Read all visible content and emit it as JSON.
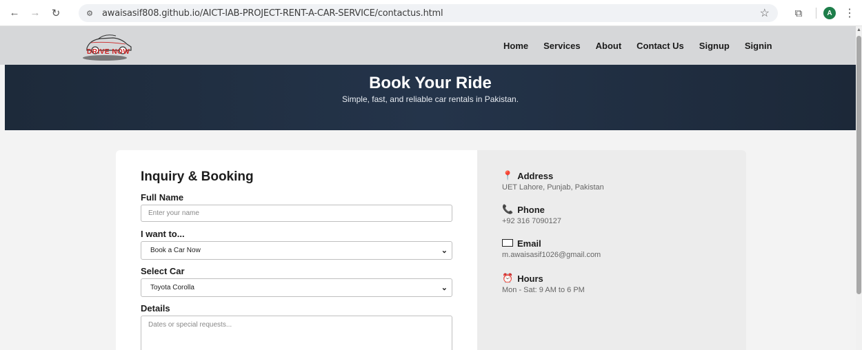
{
  "browser": {
    "url": "awaisasif808.github.io/AICT-IAB-PROJECT-RENT-A-CAR-SERVICE/contactus.html",
    "profile_initial": "A"
  },
  "site": {
    "logo_text": "DRIVE NOW",
    "nav": [
      "Home",
      "Services",
      "About",
      "Contact Us",
      "Signup",
      "Signin"
    ]
  },
  "hero": {
    "title": "Book Your Ride",
    "subtitle": "Simple, fast, and reliable car rentals in Pakistan."
  },
  "form": {
    "title": "Inquiry & Booking",
    "full_name_label": "Full Name",
    "full_name_placeholder": "Enter your name",
    "want_label": "I want to...",
    "want_value": "Book a Car Now",
    "car_label": "Select Car",
    "car_value": "Toyota Corolla",
    "details_label": "Details",
    "details_placeholder": "Dates or special requests..."
  },
  "contact": {
    "address_label": "Address",
    "address_value": "UET Lahore, Punjab, Pakistan",
    "phone_label": "Phone",
    "phone_value": "+92 316 7090127",
    "email_label": "Email",
    "email_value": "m.awaisasif1026@gmail.com",
    "hours_label": "Hours",
    "hours_value": "Mon - Sat: 9 AM to 6 PM"
  },
  "colors": {
    "hero_bg": "#1d2a3a",
    "header_bg": "#d6d7d9",
    "info_bg": "#ececec",
    "profile_bg": "#1e7e4a",
    "logo_red": "#cc2222"
  }
}
